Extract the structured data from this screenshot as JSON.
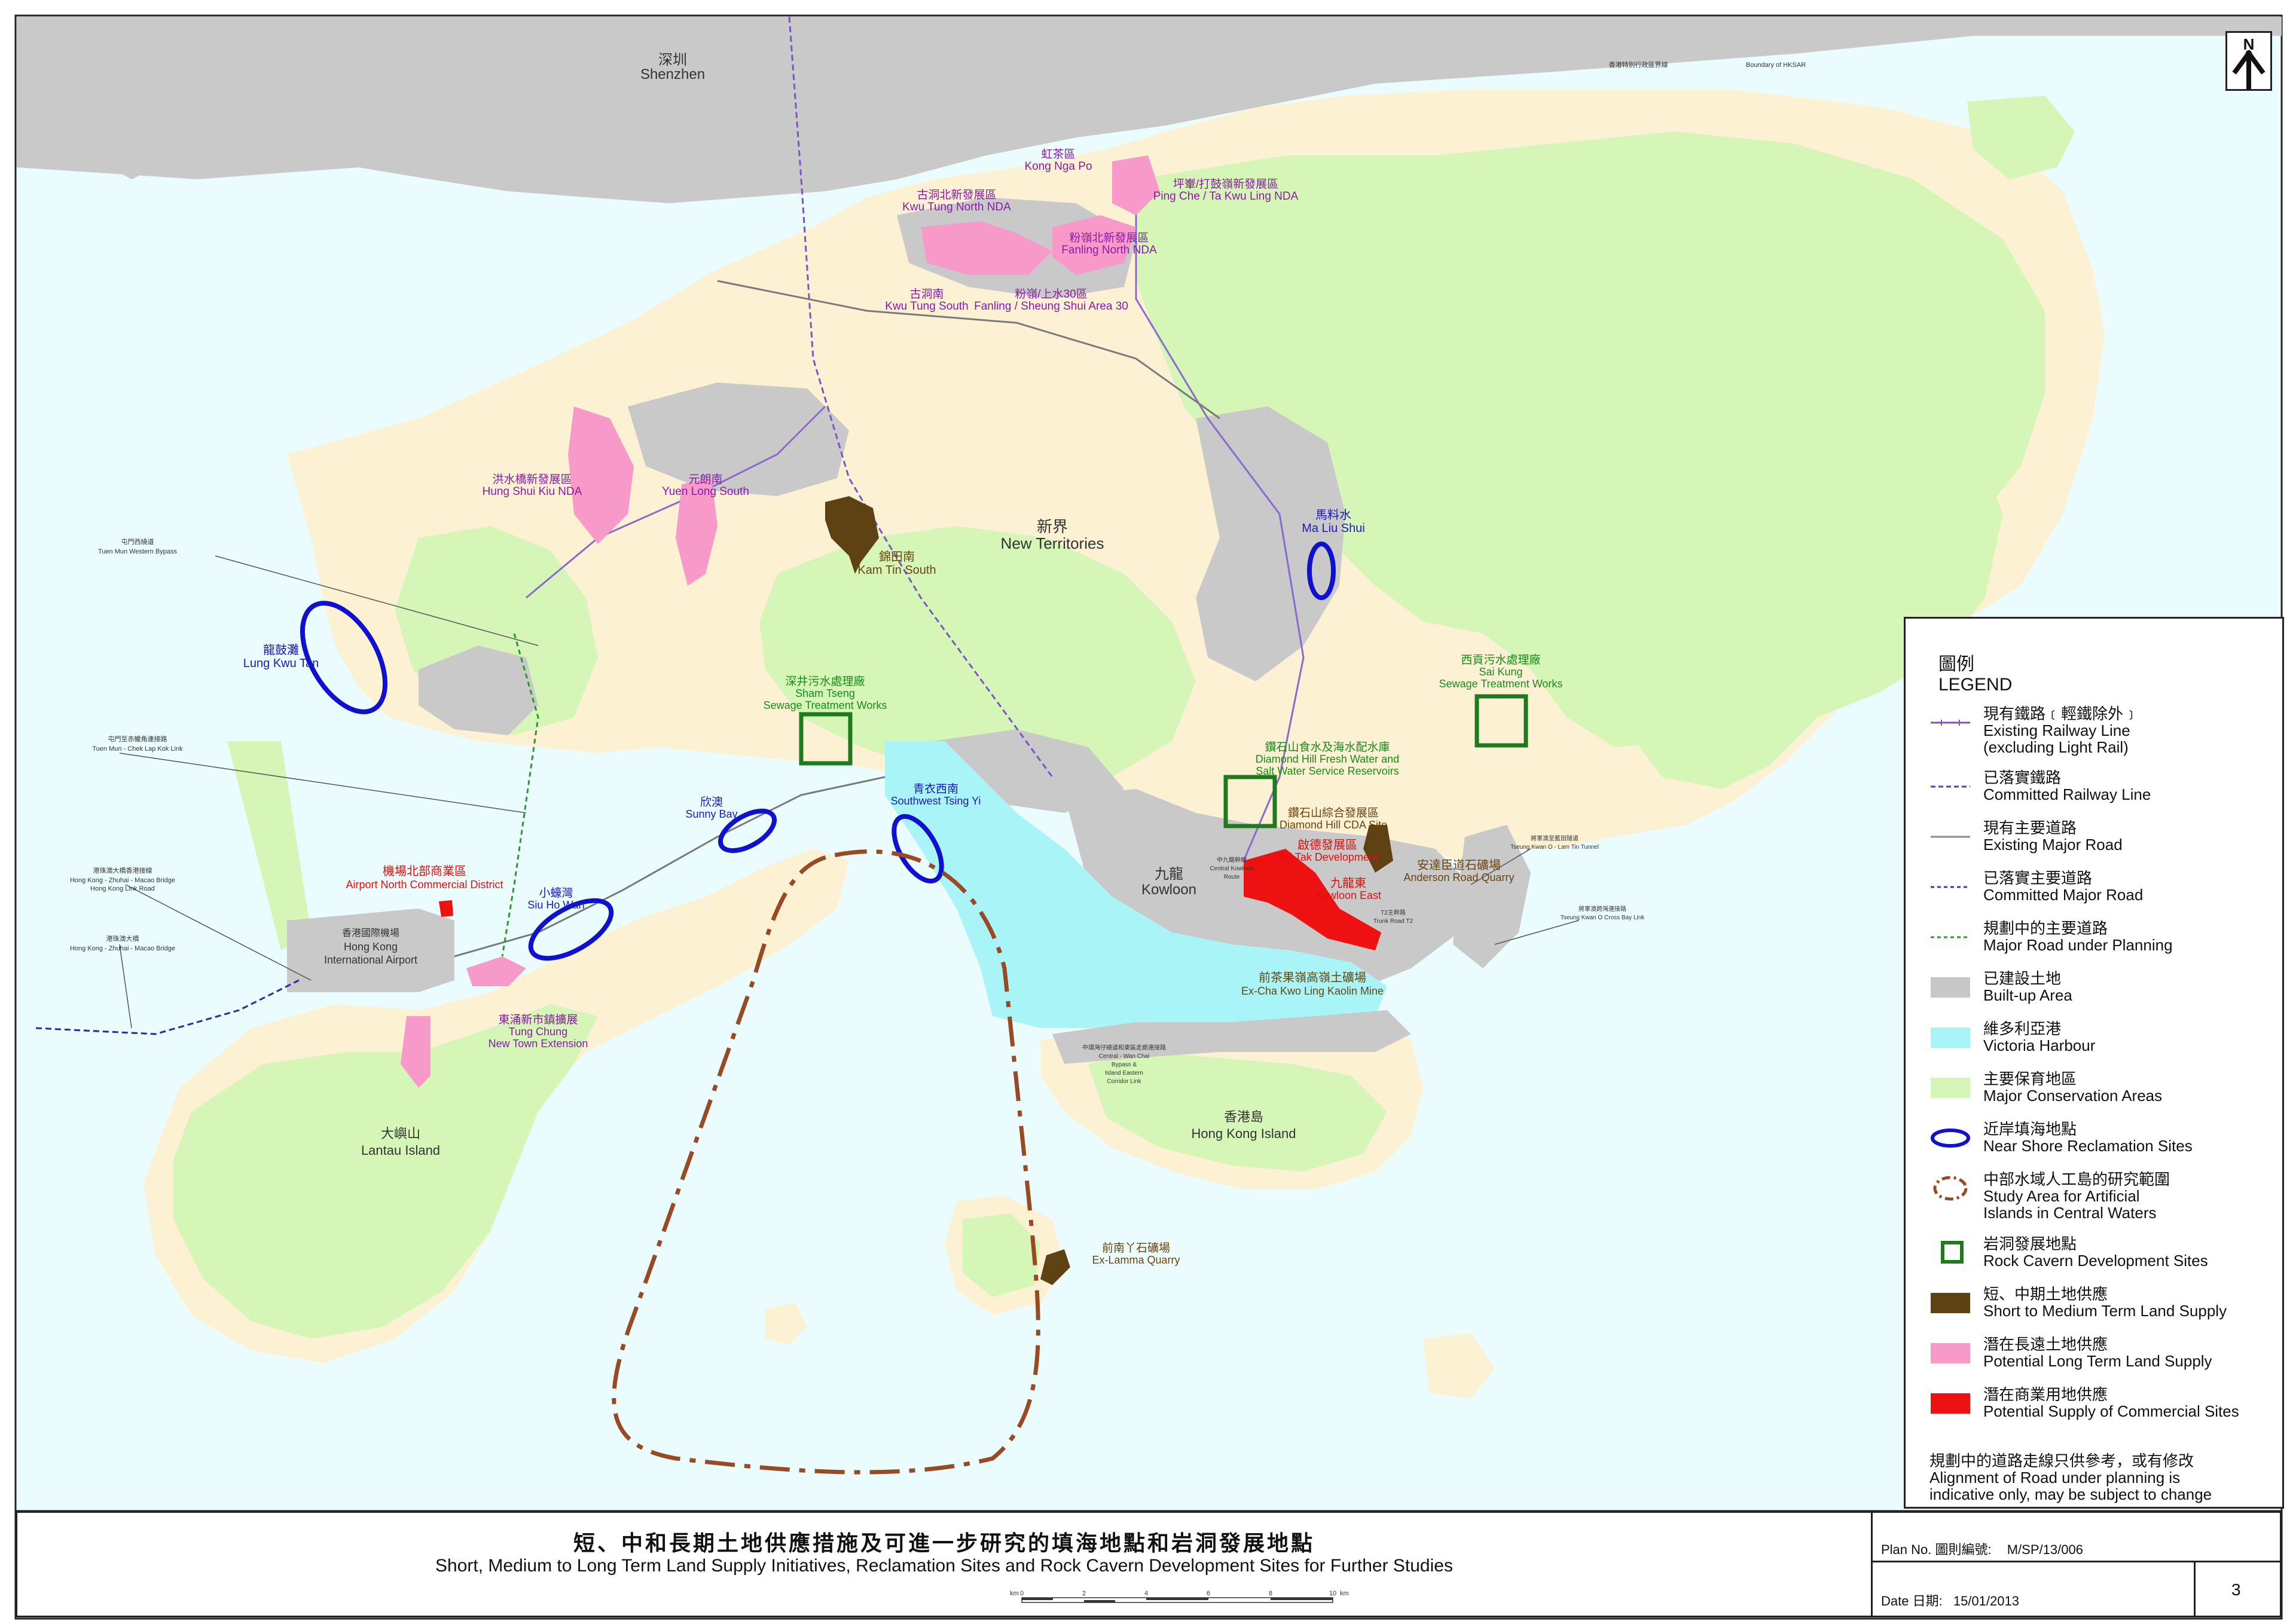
{
  "colors": {
    "sea": "#eafcfd",
    "land": "#fdf1d4",
    "conservation": "#d6f6b8",
    "builtup": "#c7c7c7",
    "harbour": "#a8f4f6",
    "reclamation": "#1010d0",
    "artificial_islands": "#9a4a22",
    "cavern": "#1f7a1f",
    "short_medium": "#5e4214",
    "long_term": "#f79ac9",
    "commercial": "#ee1111",
    "railway": "#7a54c8",
    "road": "#9a9a9a",
    "planned_road": "#2a9a2a",
    "label_purple": "#8a1aa8",
    "label_blue": "#1a1ab8",
    "label_green": "#1a8a1a",
    "label_brown": "#6a4410",
    "label_red": "#e01010"
  },
  "map": {
    "regions": {
      "shenzhen_cn": "深圳",
      "shenzhen_en": "Shenzhen",
      "nt_cn": "新界",
      "nt_en": "New Territories",
      "kowloon_cn": "九龍",
      "kowloon_en": "Kowloon",
      "hki_cn": "香港島",
      "hki_en": "Hong Kong Island",
      "lantau_cn": "大嶼山",
      "lantau_en": "Lantau Island",
      "airport_cn": "香港國際機場",
      "airport_en1": "Hong Kong",
      "airport_en2": "International Airport",
      "boundary_cn": "香港特別行政區界線",
      "boundary_en": "Boundary of HKSAR"
    },
    "sites": {
      "kong_nga_po_cn": "虹茶區",
      "kong_nga_po_en": "Kong Nga Po",
      "kwu_tung_north_cn": "古洞北新發展區",
      "kwu_tung_north_en": "Kwu Tung North NDA",
      "ping_che_cn": "坪輋/打鼓嶺新發展區",
      "ping_che_en": "Ping Che / Ta Kwu Ling NDA",
      "fanling_north_cn": "粉嶺北新發展區",
      "fanling_north_en": "Fanling North NDA",
      "kwu_tung_south_cn": "古洞南",
      "kwu_tung_south_en": "Kwu Tung South",
      "fanling_ss_cn": "粉嶺/上水30區",
      "fanling_ss_en": "Fanling / Sheung Shui Area 30",
      "hsk_cn": "洪水橋新發展區",
      "hsk_en": "Hung Shui Kiu NDA",
      "yls_cn": "元朗南",
      "yls_en": "Yuen Long South",
      "kam_tin_cn": "錦田南",
      "kam_tin_en": "Kam Tin South",
      "ma_liu_shui_cn": "馬料水",
      "ma_liu_shui_en": "Ma Liu Shui",
      "lung_kwu_tan_cn": "龍鼓灘",
      "lung_kwu_tan_en": "Lung Kwu Tan",
      "sham_tseng_cn": "深井污水處理廠",
      "sham_tseng_en1": "Sham Tseng",
      "sham_tseng_en2": "Sewage Treatment Works",
      "sai_kung_cn": "西貢污水處理廠",
      "sai_kung_en1": "Sai Kung",
      "sai_kung_en2": "Sewage Treatment Works",
      "sunny_bay_cn": "欣澳",
      "sunny_bay_en": "Sunny Bay",
      "sw_tsing_yi_cn": "青衣西南",
      "sw_tsing_yi_en": "Southwest Tsing Yi",
      "dh_reservoir_cn": "鑽石山食水及海水配水庫",
      "dh_reservoir_en1": "Diamond Hill Fresh Water and",
      "dh_reservoir_en2": "Salt Water Service Reservoirs",
      "dh_cda_cn": "鑽石山綜合發展區",
      "dh_cda_en": "Diamond Hill CDA Site",
      "kai_tak_cn": "啟德發展區",
      "kai_tak_en": "Kai Tak Development",
      "kowloon_east_cn": "九龍東",
      "kowloon_east_en": "Kowloon East",
      "anderson_cn": "安達臣道石礦場",
      "anderson_en": "Anderson Road Quarry",
      "airport_north_cn": "機場北部商業區",
      "airport_north_en": "Airport North Commercial District",
      "siu_ho_wan_cn": "小蠔灣",
      "siu_ho_wan_en": "Siu Ho Wan",
      "tung_chung_cn": "東涌新市鎮擴展",
      "tung_chung_en1": "Tung Chung",
      "tung_chung_en2": "New Town Extension",
      "ckl_cn": "前茶果嶺高嶺土礦場",
      "ckl_en": "Ex-Cha Kwo Ling Kaolin Mine",
      "lamma_cn": "前南丫石礦場",
      "lamma_en": "Ex-Lamma Quarry"
    },
    "roads": {
      "tmwb_cn": "屯門西繞道",
      "tmwb_en": "Tuen Mun Western Bypass",
      "tmclk_cn": "屯門至赤鱲角連接路",
      "tmclk_en": "Tuen Mun - Chek Lap Kok Link",
      "hzmb_link_cn": "港珠澳大橋香港接線",
      "hzmb_link_en1": "Hong Kong - Zhuhai - Macao Bridge",
      "hzmb_link_en2": "Hong Kong Link Road",
      "hzmb_cn": "港珠澳大橋",
      "hzmb_en": "Hong Kong - Zhuhai - Macao Bridge",
      "tko_lt_cn": "將軍澳至藍田隧道",
      "tko_lt_en": "Tseung Kwan O - Lam Tin Tunnel",
      "tko_cb_cn": "將軍澳跨灣連接路",
      "tko_cb_en": "Tseung Kwan O Cross Bay Link",
      "cwb_cn": "中九龍幹線",
      "cwb_en1": "Central Kowloon",
      "cwb_en2": "Route",
      "t2_cn": "T2主幹路",
      "t2_en": "Trunk Road T2",
      "cwbl_cn": "中環灣仔繞道和東區走廊連接路",
      "cwbl_en1": "Central - Wan Chai",
      "cwbl_en2": "Bypass &",
      "cwbl_en3": "Island Eastern",
      "cwbl_en4": "Corridor Link"
    }
  },
  "legend": {
    "title_cn": "圖例",
    "title_en": "LEGEND",
    "items": [
      {
        "cn": "現有鐵路﹝輕鐵除外﹞",
        "en1": "Existing Railway Line",
        "en2": "(excluding Light Rail)",
        "symbol": "railway-existing"
      },
      {
        "cn": "已落實鐵路",
        "en1": "Committed Railway Line",
        "en2": "",
        "symbol": "railway-committed"
      },
      {
        "cn": "現有主要道路",
        "en1": "Existing Major Road",
        "en2": "",
        "symbol": "road-existing"
      },
      {
        "cn": "已落實主要道路",
        "en1": "Committed Major Road",
        "en2": "",
        "symbol": "road-committed"
      },
      {
        "cn": "規劃中的主要道路",
        "en1": "Major Road under Planning",
        "en2": "",
        "symbol": "road-planning"
      },
      {
        "cn": "已建設土地",
        "en1": "Built-up Area",
        "en2": "",
        "symbol": "fill-builtup"
      },
      {
        "cn": "維多利亞港",
        "en1": "Victoria Harbour",
        "en2": "",
        "symbol": "fill-harbour"
      },
      {
        "cn": "主要保育地區",
        "en1": "Major Conservation Areas",
        "en2": "",
        "symbol": "fill-conservation"
      },
      {
        "cn": "近岸填海地點",
        "en1": "Near Shore Reclamation Sites",
        "en2": "",
        "symbol": "ellipse-blue"
      },
      {
        "cn": "中部水域人工島的研究範圍",
        "en1": "Study Area for Artificial",
        "en2": "Islands in Central Waters",
        "symbol": "dash-ellipse-brown"
      },
      {
        "cn": "岩洞發展地點",
        "en1": "Rock Cavern Development Sites",
        "en2": "",
        "symbol": "square-green"
      },
      {
        "cn": "短、中期土地供應",
        "en1": "Short to Medium Term Land Supply",
        "en2": "",
        "symbol": "fill-brown"
      },
      {
        "cn": "潛在長遠土地供應",
        "en1": "Potential Long Term Land Supply",
        "en2": "",
        "symbol": "fill-pink"
      },
      {
        "cn": "潛在商業用地供應",
        "en1": "Potential Supply of Commercial Sites",
        "en2": "",
        "symbol": "fill-red"
      }
    ],
    "note_cn": "規劃中的道路走線只供參考，或有修改",
    "note_en1": "Alignment of Road under planning is",
    "note_en2": "indicative only, may be subject to change"
  },
  "title_block": {
    "title_cn": "短、中和長期土地供應措施及可進一步研究的填海地點和岩洞發展地點",
    "title_en": "Short, Medium to Long Term Land Supply Initiatives, Reclamation Sites and Rock Cavern Development Sites for Further Studies",
    "plan_no_label": "Plan No.  圖則編號:",
    "plan_no": "M/SP/13/006",
    "date_label": "Date  日期:",
    "date": "15/01/2013",
    "sheet_no": "3"
  },
  "scale_bar": {
    "unit_left": "km",
    "unit_right": "km",
    "ticks": [
      "0",
      "2",
      "4",
      "6",
      "8",
      "10"
    ]
  },
  "north_arrow": {
    "label": "N"
  }
}
